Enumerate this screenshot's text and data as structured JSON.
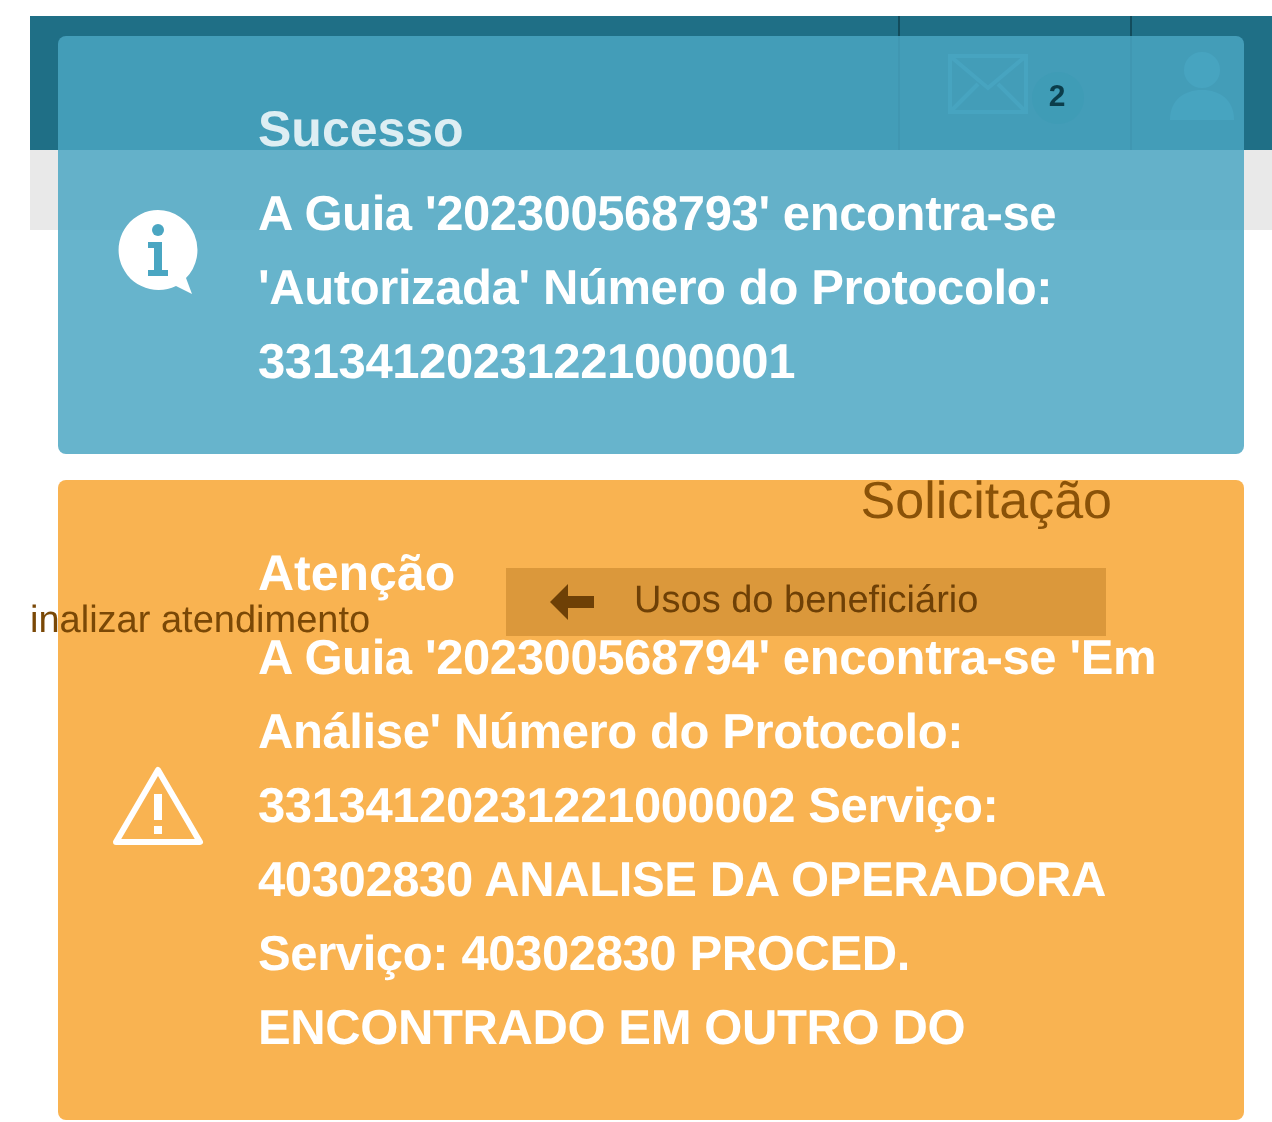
{
  "header": {
    "mail_badge": "2"
  },
  "page": {
    "title": "Solicitação",
    "finish_link": "inalizar atendimento",
    "history_button": "Usos do beneficiário"
  },
  "notifications": [
    {
      "kind": "success",
      "title": "Sucesso",
      "message": "A Guia '202300568793' encontra-se 'Autorizada' Número do Protocolo: 33134120231221000001"
    },
    {
      "kind": "warning",
      "title": "Atenção",
      "message": "A Guia '202300568794' encontra-se 'Em Análise' Número do Protocolo: 33134120231221000002 Serviço: 40302830 ANALISE DA OPERADORA Serviço: 40302830 PROCED. ENCONTRADO EM OUTRO DO"
    }
  ]
}
